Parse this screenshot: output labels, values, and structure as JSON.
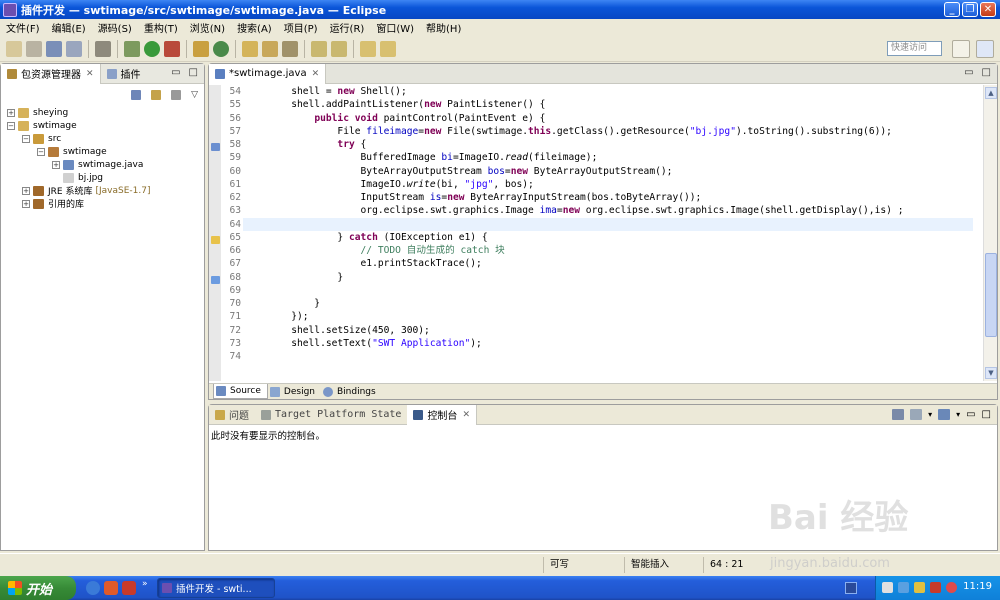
{
  "window": {
    "title": "插件开发 — swtimage/src/swtimage/swtimage.java — Eclipse"
  },
  "menu": [
    "文件(F)",
    "编辑(E)",
    "源码(S)",
    "重构(T)",
    "浏览(N)",
    "搜索(A)",
    "项目(P)",
    "运行(R)",
    "窗口(W)",
    "帮助(H)"
  ],
  "toolbar": {
    "quick_access_placeholder": "快速访问"
  },
  "left_panel": {
    "tabs": [
      {
        "label": "包资源管理器",
        "active": true
      },
      {
        "label": "插件",
        "active": false
      }
    ],
    "tree": [
      {
        "label": "sheying",
        "level": 0,
        "expander": "+",
        "icon": "project-icon"
      },
      {
        "label": "swtimage",
        "level": 0,
        "expander": "-",
        "icon": "project-icon"
      },
      {
        "label": "src",
        "level": 1,
        "expander": "-",
        "icon": "source-folder-icon"
      },
      {
        "label": "swtimage",
        "level": 2,
        "expander": "-",
        "icon": "package-icon"
      },
      {
        "label": "swtimage.java",
        "level": 3,
        "expander": "+",
        "icon": "java-file-icon"
      },
      {
        "label": "bj.jpg",
        "level": 3,
        "expander": "",
        "icon": "image-file-icon"
      },
      {
        "label": "JRE 系统库",
        "level": 1,
        "expander": "+",
        "icon": "library-icon",
        "suffix": "[JavaSE-1.7]"
      },
      {
        "label": "引用的库",
        "level": 1,
        "expander": "+",
        "icon": "library-icon"
      }
    ]
  },
  "editor": {
    "tab_label": "*swtimage.java",
    "line_numbers": [
      "54",
      "55",
      "56",
      "57",
      "58",
      "59",
      "60",
      "61",
      "62",
      "63",
      "64",
      "65",
      "66",
      "67",
      "68",
      "69",
      "70",
      "71",
      "72",
      "73",
      "74"
    ],
    "code": [
      "        shell = new Shell();",
      "        shell.addPaintListener(new PaintListener() {",
      "            public void paintControl(PaintEvent e) {",
      "                File fileimage=new File(swtimage.this.getClass().getResource(\"bj.jpg\").toString().substring(6));",
      "                try {",
      "                    BufferedImage bi=ImageIO.read(fileimage);",
      "                    ByteArrayOutputStream bos=new ByteArrayOutputStream();",
      "                    ImageIO.write(bi, \"jpg\", bos);",
      "                    InputStream is=new ByteArrayInputStream(bos.toByteArray());",
      "                    org.eclipse.swt.graphics.Image ima=new org.eclipse.swt.graphics.Image(shell.getDisplay(),is) ;",
      "",
      "                } catch (IOException e1) {",
      "                    // TODO 自动生成的 catch 块",
      "                    e1.printStackTrace();",
      "                }",
      "",
      "            }",
      "        });",
      "        shell.setSize(450, 300);",
      "        shell.setText(\"SWT Application\");",
      ""
    ],
    "bottom_tabs": [
      {
        "label": "Source",
        "active": true
      },
      {
        "label": "Design",
        "active": false
      },
      {
        "label": "Bindings",
        "active": false
      }
    ]
  },
  "console": {
    "tabs": [
      {
        "label": "问题",
        "active": false
      },
      {
        "label": "Target Platform State",
        "active": false
      },
      {
        "label": "控制台",
        "active": true
      }
    ],
    "message": "此时没有要显示的控制台。"
  },
  "status": {
    "writable": "可写",
    "insert_mode": "智能插入",
    "position": "64 : 21"
  },
  "taskbar": {
    "start_label": "开始",
    "task_item": "插件开发 - swti...",
    "clock": "11:19"
  },
  "watermark": {
    "text": "Bai 经验",
    "url": "jingyan.baidu.com"
  }
}
